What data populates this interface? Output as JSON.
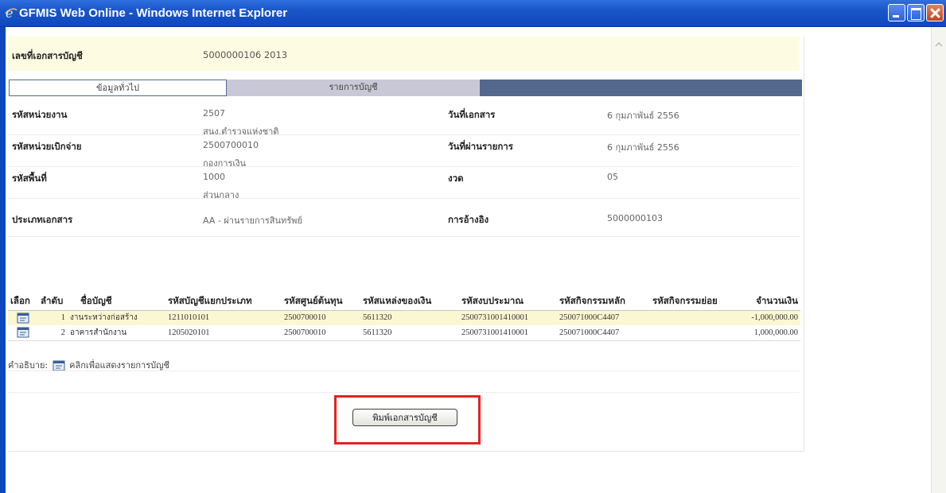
{
  "window": {
    "title": "GFMIS Web Online - Windows Internet Explorer"
  },
  "doc_header": {
    "label": "เลขที่เอกสารบัญชี",
    "value": "5000000106  2013"
  },
  "tabs": [
    {
      "label": "ข้อมูลทั่วไป"
    },
    {
      "label": "รายการบัญชี"
    }
  ],
  "info": {
    "agency_code": {
      "label": "รหัสหน่วยงาน",
      "value": "2507",
      "sub": "สนง.ตำรวจแห่งชาติ"
    },
    "doc_date": {
      "label": "วันที่เอกสาร",
      "value": "6 กุมภาพันธ์ 2556"
    },
    "disbursing_unit": {
      "label": "รหัสหน่วยเบิกจ่าย",
      "value": "2500700010",
      "sub": "กองการเงิน"
    },
    "posting_date": {
      "label": "วันที่ผ่านรายการ",
      "value": "6 กุมภาพันธ์ 2556"
    },
    "area_code": {
      "label": "รหัสพื้นที่",
      "value": "1000",
      "sub": "ส่วนกลาง"
    },
    "period": {
      "label": "งวด",
      "value": "05"
    },
    "doc_type": {
      "label": "ประเภทเอกสาร",
      "value": "AA - ผ่านรายการสินทรัพย์"
    },
    "reference": {
      "label": "การอ้างอิง",
      "value": "5000000103"
    }
  },
  "table": {
    "headers": [
      "เลือก",
      "ลำดับ",
      "ชื่อบัญชี",
      "รหัสบัญชีแยกประเภท",
      "รหัสศูนย์ต้นทุน",
      "รหัสแหล่งของเงิน",
      "รหัสงบประมาณ",
      "รหัสกิจกรรมหลัก",
      "รหัสกิจกรรมย่อย",
      "จำนวนเงิน"
    ],
    "rows": [
      {
        "seq": "1",
        "name": "งานระหว่างก่อสร้าง",
        "gl": "1211010101",
        "cost_center": "2500700010",
        "fund": "5611320",
        "budget": "2500731001410001",
        "main_activity": "250071000C4407",
        "sub_activity": "",
        "amount": "-1,000,000.00"
      },
      {
        "seq": "2",
        "name": "อาคารสำนักงาน",
        "gl": "1205020101",
        "cost_center": "2500700010",
        "fund": "5611320",
        "budget": "2500731001410001",
        "main_activity": "250071000C4407",
        "sub_activity": "",
        "amount": "1,000,000.00"
      }
    ]
  },
  "legend": {
    "prefix": "คำอธิบาย:",
    "text": "คลิกเพื่อแสดงรายการบัญชี"
  },
  "print_button": {
    "label": "พิมพ์เอกสารบัญชี"
  },
  "colors": {
    "titlebar": "#1a55c9",
    "header_bg": "#fdfbe2",
    "tab_bar": "#54688e",
    "highlight": "#e32222"
  }
}
